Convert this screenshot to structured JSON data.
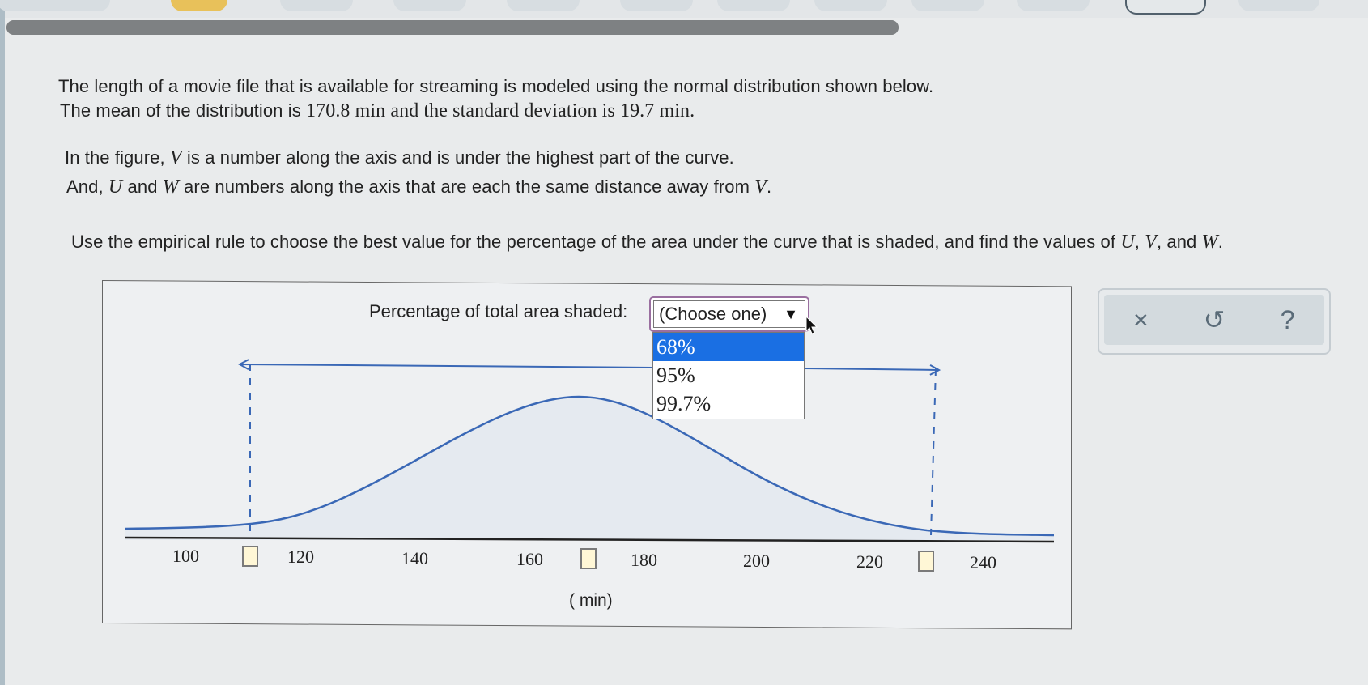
{
  "question": {
    "line1": "The length of a movie file that is available for streaming is modeled using the normal distribution shown below.",
    "line2_a": "The mean of the distribution is ",
    "mean": "170.8",
    "line2_b": " min and the standard deviation is ",
    "sd": "19.7",
    "line2_c": " min.",
    "line3_a": "In the figure, ",
    "var_v": "V",
    "line3_b": " is a number along the axis and is under the highest part of the curve.",
    "line4_a": "And, ",
    "var_u": "U",
    "line4_and": " and ",
    "var_w": "W",
    "line4_b": " are numbers along the axis that are each the same distance away from ",
    "line4_end": ".",
    "line5_a": "Use the empirical rule to choose the best value for the percentage of the area under the curve that is shaded, and find the values of ",
    "sep_comma": ", ",
    "line5_and": ", and ",
    "line5_end": "."
  },
  "figure": {
    "percentage_label": "Percentage of total area shaded:",
    "select_value": "(Choose one)",
    "options": [
      "68%",
      "95%",
      "99.7%"
    ],
    "highlighted_option": "68%",
    "tick_labels": [
      "100",
      "120",
      "140",
      "160",
      "180",
      "200",
      "220",
      "240"
    ],
    "unit": "( min)"
  },
  "tools": {
    "clear": "×",
    "undo": "↺",
    "help": "?"
  },
  "colors": {
    "curve": "#3a68b6",
    "selected_option": "#1a6fe3",
    "answer_box": "#fff7d6"
  }
}
